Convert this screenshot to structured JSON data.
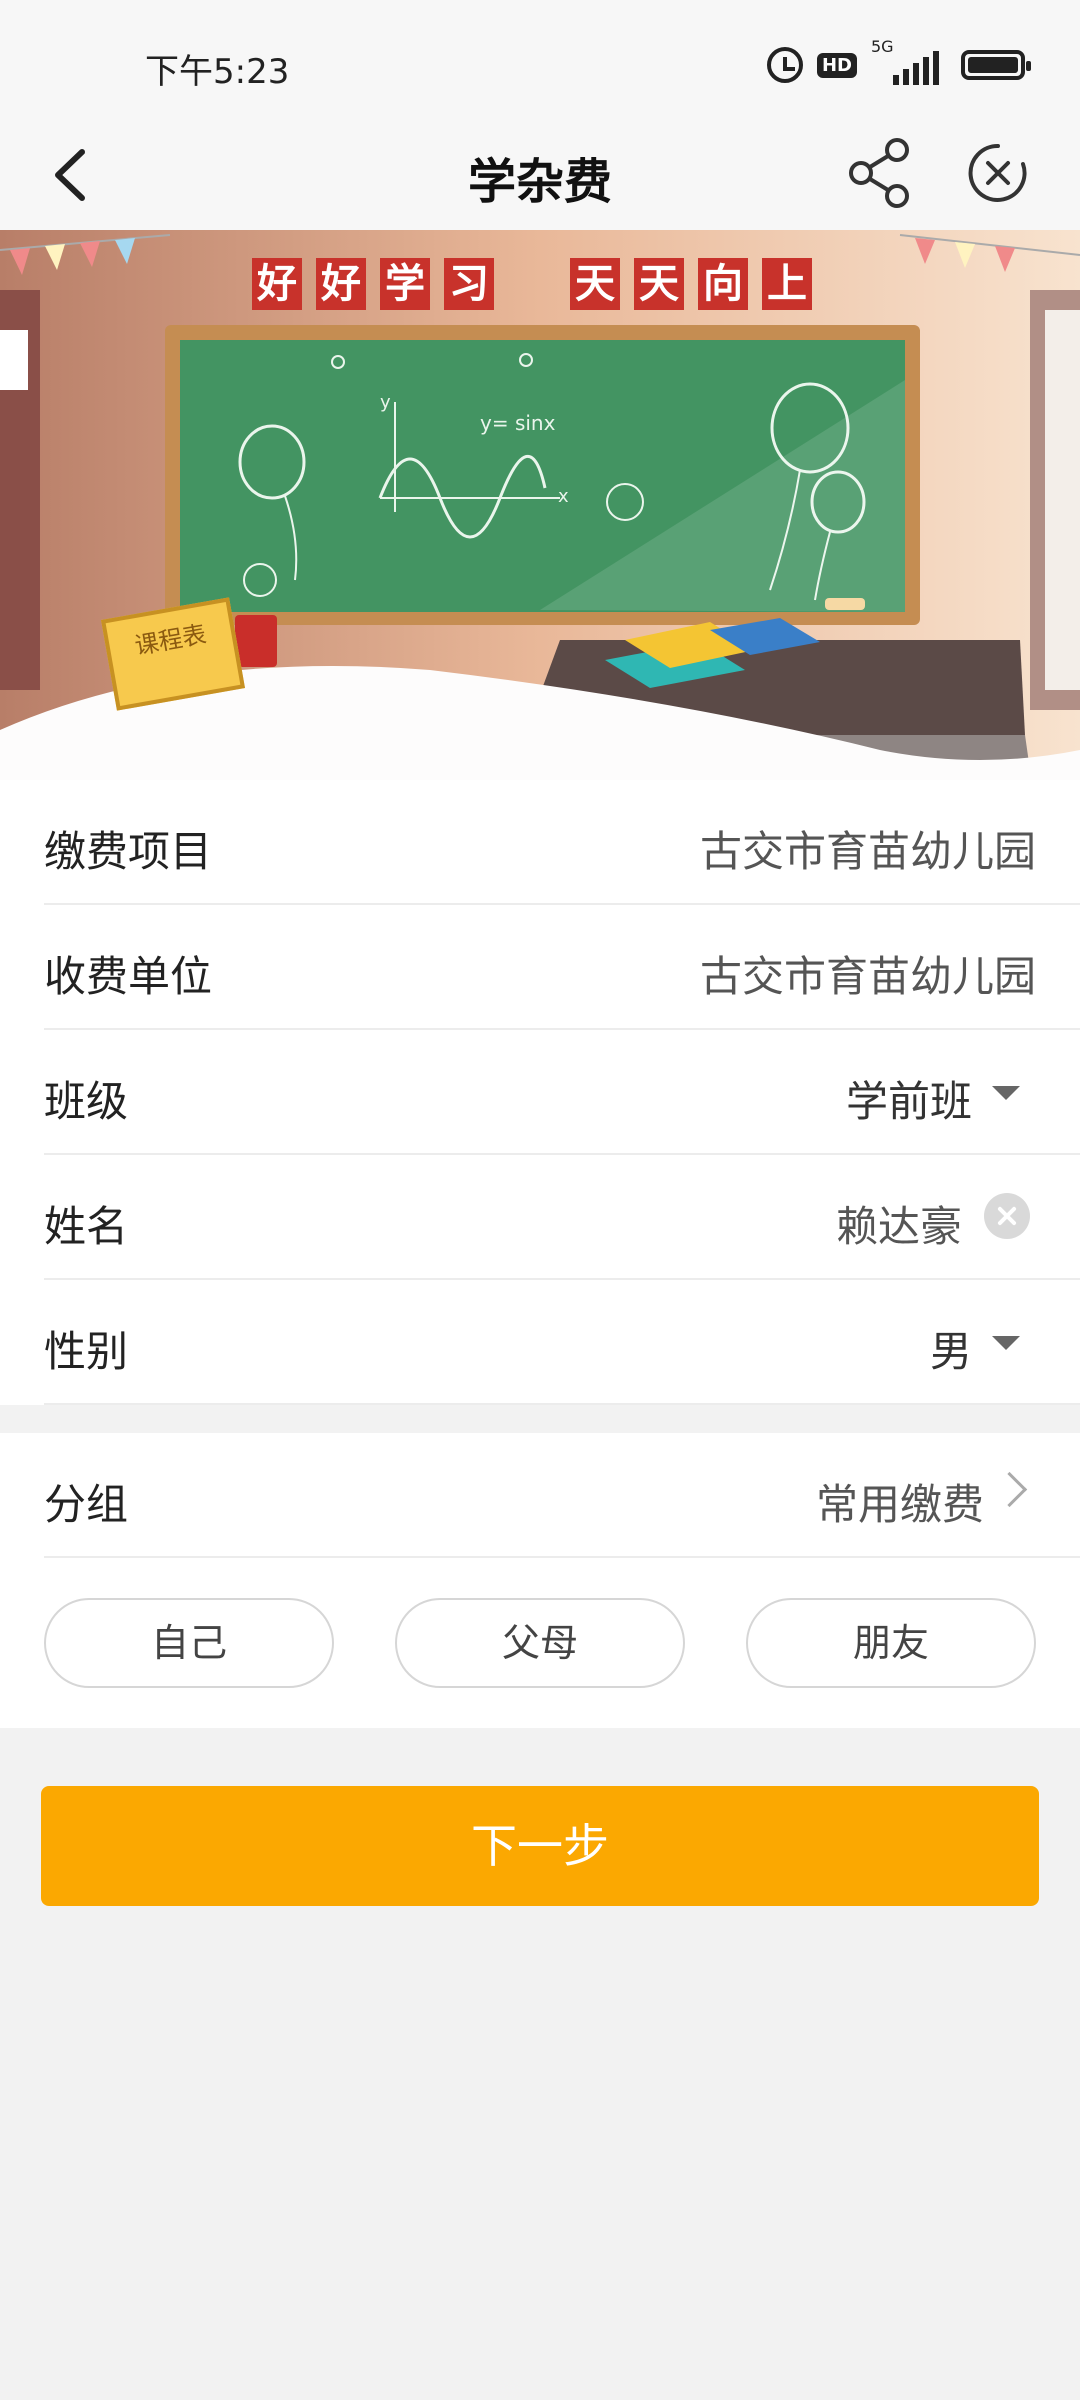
{
  "status": {
    "time": "下午5:23",
    "hd": "HD",
    "network": "5G"
  },
  "header": {
    "title": "学杂费"
  },
  "banner": {
    "slogan_left": [
      "好",
      "好",
      "学",
      "习"
    ],
    "slogan_right": [
      "天",
      "天",
      "向",
      "上"
    ],
    "board_formula": "y= sinx",
    "board_axis_y": "y",
    "board_axis_x": "x",
    "schedule_label": "课程表"
  },
  "form": {
    "rows": [
      {
        "label": "缴费项目",
        "value": "古交市育苗幼儿园"
      },
      {
        "label": "收费单位",
        "value": "古交市育苗幼儿园"
      },
      {
        "label": "班级",
        "value": "学前班"
      },
      {
        "label": "姓名",
        "value": "赖达豪"
      },
      {
        "label": "性别",
        "value": "男"
      }
    ]
  },
  "group": {
    "label": "分组",
    "value": "常用缴费",
    "options": [
      "自己",
      "父母",
      "朋友"
    ]
  },
  "actions": {
    "next_label": "下一步"
  },
  "colors": {
    "accent": "#fba801",
    "board": "#3f8e5e",
    "slogan_bg": "#c8322b"
  }
}
